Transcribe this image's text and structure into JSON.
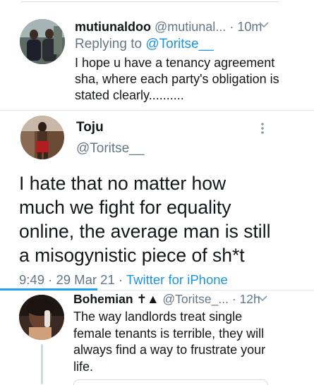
{
  "tweet1": {
    "display_name": "mutiunaldoo",
    "handle": "@mutiunal...",
    "time": "· 10m",
    "replying_prefix": "Replying to",
    "replying_handle": "@Toritse__",
    "text_lines": [
      "I hope u have a tenancy agreement",
      "sha, where each party's obligation is",
      "stated clearly.........."
    ]
  },
  "main_tweet": {
    "display_name": "Toju",
    "handle": "@Toritse__",
    "text_lines": [
      "I hate that no matter how",
      "much we fight for equality",
      "online, the average man is still",
      "a misogynistic piece of sh*t"
    ],
    "timestamp": "9:49 · 29 Mar 21 ·",
    "source": "Twitter for iPhone"
  },
  "tweet3": {
    "display_name": "Bohemian ✝▲",
    "handle": "@Toritse_...",
    "time": "· 12h",
    "text_lines": [
      "The way landlords treat single",
      "female tenants is terrible, they will",
      "always find a way to frustrate your",
      "life."
    ]
  },
  "icons": {
    "chevron": "chevron-down-icon",
    "more": "more-vertical-icon"
  },
  "colors": {
    "link": "#1b95e0",
    "secondary_text": "#657786",
    "accent": "#1da1f2"
  }
}
